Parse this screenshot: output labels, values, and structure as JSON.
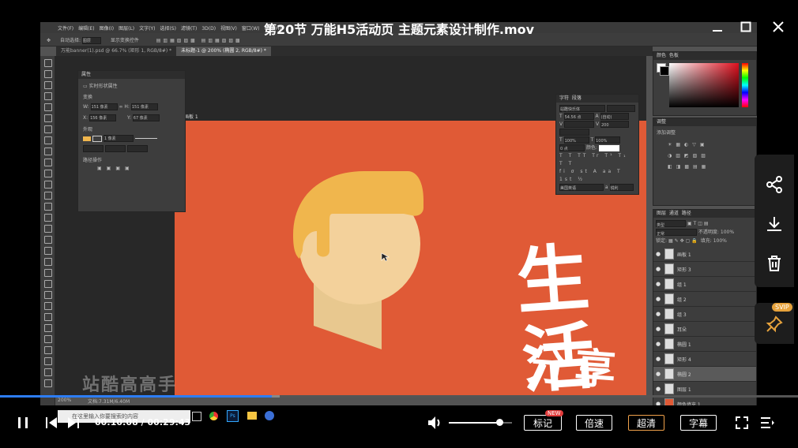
{
  "player": {
    "title": "第20节 万能H5活动页 主题元素设计制作.mov",
    "current_time": "00:10:08",
    "separator": "/",
    "total_time": "00:29:43",
    "progress": 0.341,
    "loaded": 0.35,
    "volume": 0.8,
    "buttons": {
      "mark": "标记",
      "mark_badge": "NEW",
      "speed": "倍速",
      "quality": "超清",
      "subtitle": "字幕"
    },
    "svip_badge": "SVIP",
    "accent": "#2d7df6",
    "quality_color": "#f0a14a"
  },
  "photoshop": {
    "menu": [
      "文件(F)",
      "编辑(E)",
      "图像(I)",
      "图层(L)",
      "文字(Y)",
      "选择(S)",
      "滤镜(T)",
      "3D(D)",
      "视图(V)",
      "窗口(W)",
      "帮助(H)"
    ],
    "options": {
      "auto_select": "自动选择:",
      "auto_select_value": "图层",
      "show_transform": "显示变换控件"
    },
    "tabs": [
      {
        "label": "万能banner(1).psd @ 66.7% (矩形 1, RGB/8#) *",
        "active": false
      },
      {
        "label": "未标题-1 @ 200% (椭圆 2, RGB/8#) *",
        "active": true
      }
    ],
    "zoom": "200%",
    "doc_info": "文档:7.31M/6.40M",
    "search_placeholder": "在这里输入你要搜索的内容",
    "properties": {
      "title": "属性",
      "shape_label": "实时形状属性",
      "transform_label": "变换",
      "w_label": "W:",
      "w_value": "151 像素",
      "h_label": "H:",
      "h_value": "151 像素",
      "x_label": "X:",
      "x_value": "156 像素",
      "y_label": "Y:",
      "y_value": "67 像素",
      "appearance_label": "外观",
      "stroke_value": "1 像素",
      "path_ops_label": "路径操作"
    },
    "character": {
      "tab1": "字符",
      "tab2": "段落",
      "font": "站酷快乐体",
      "size": "54.56 点",
      "leading": "(自动)",
      "tracking": "200",
      "v_scale": "100%",
      "h_scale": "100%",
      "baseline": "0 点",
      "color_label": "颜色:",
      "color_value": "#ffffff",
      "lang": "美国英语",
      "aa": "锐利"
    },
    "color_panel": {
      "tab1": "颜色",
      "tab2": "色板"
    },
    "adjust_panel": {
      "title": "调整",
      "add_label": "添加调整"
    },
    "layers": {
      "tabs": [
        "图层",
        "通道",
        "路径"
      ],
      "kind": "类型",
      "blend": "正常",
      "opacity_label": "不透明度:",
      "opacity": "100%",
      "lock_label": "锁定:",
      "fill_label": "填充:",
      "fill": "100%",
      "items": [
        {
          "name": "画板 1",
          "selected": false
        },
        {
          "name": "矩形 3",
          "selected": false
        },
        {
          "name": "组 1",
          "selected": false
        },
        {
          "name": "组 2",
          "selected": false
        },
        {
          "name": "组 3",
          "selected": false
        },
        {
          "name": "耳朵",
          "selected": false
        },
        {
          "name": "椭圆 1",
          "selected": false
        },
        {
          "name": "矩形 4",
          "selected": false
        },
        {
          "name": "椭圆 2",
          "selected": true
        },
        {
          "name": "图层 1",
          "selected": false
        },
        {
          "name": "颜色填充 1",
          "selected": false
        }
      ]
    },
    "artboard_label": "画板 1",
    "headline": "生活",
    "subline": "分享你",
    "colors": {
      "artboard": "#e05a36",
      "hair": "#f0b64d",
      "face": "#f3d19b",
      "neck": "#e8c88f"
    }
  },
  "watermark": "站酷高高手",
  "icons": [
    "share-icon",
    "download-icon",
    "trash-icon",
    "pin-icon",
    "play-pause-icon",
    "prev-icon",
    "next-icon",
    "volume-icon",
    "fullscreen-icon",
    "playlist-icon",
    "minimize-icon",
    "restore-icon",
    "close-icon"
  ]
}
